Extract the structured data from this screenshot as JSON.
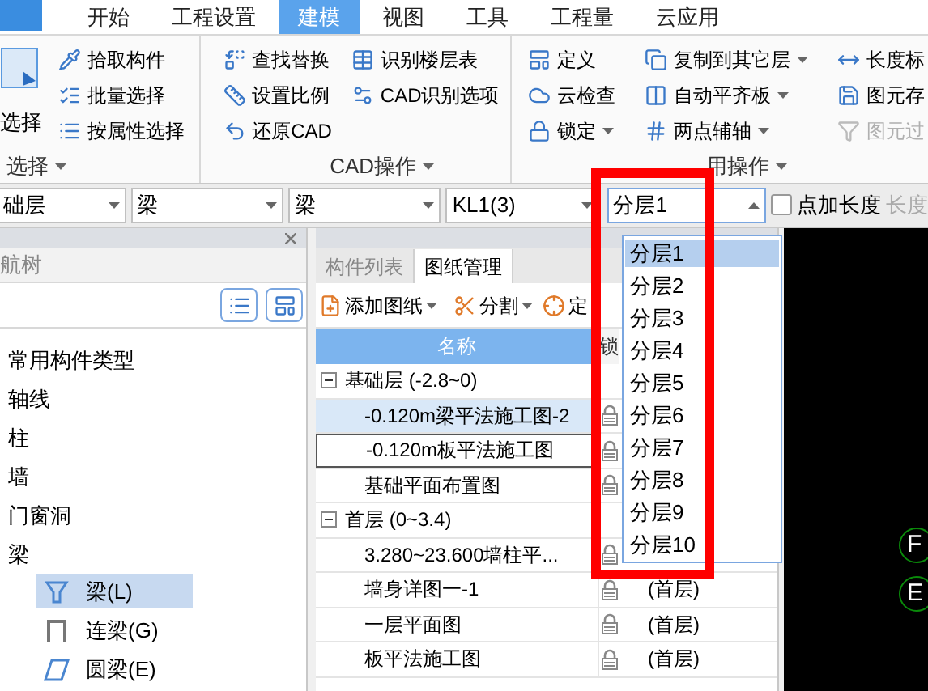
{
  "tabs": [
    {
      "label": "开始",
      "selected": false
    },
    {
      "label": "工程设置",
      "selected": false
    },
    {
      "label": "建模",
      "selected": true
    },
    {
      "label": "视图",
      "selected": false
    },
    {
      "label": "工具",
      "selected": false
    },
    {
      "label": "工程量",
      "selected": false
    },
    {
      "label": "云应用",
      "selected": false
    }
  ],
  "ribbon": {
    "groups": [
      {
        "kind": "select",
        "label": "选择",
        "large_button": "选择",
        "columns": [
          [
            {
              "label": "拾取构件",
              "has_menu": false,
              "disabled": false
            },
            {
              "label": "批量选择",
              "has_menu": false,
              "disabled": false
            },
            {
              "label": "按属性选择",
              "has_menu": false,
              "disabled": false
            }
          ]
        ]
      },
      {
        "kind": "cad",
        "label": "CAD操作",
        "columns": [
          [
            {
              "label": "查找替换",
              "has_menu": false,
              "disabled": false
            },
            {
              "label": "设置比例",
              "has_menu": false,
              "disabled": false
            },
            {
              "label": "还原CAD",
              "has_menu": false,
              "disabled": false
            }
          ],
          [
            {
              "label": "识别楼层表",
              "has_menu": false,
              "disabled": false
            },
            {
              "label": "CAD识别选项",
              "has_menu": false,
              "disabled": false
            }
          ]
        ]
      },
      {
        "kind": "common",
        "label": "用操作",
        "columns": [
          [
            {
              "label": "定义",
              "has_menu": false,
              "disabled": false
            },
            {
              "label": "云检查",
              "has_menu": false,
              "disabled": false
            },
            {
              "label": "锁定",
              "has_menu": true,
              "disabled": false
            }
          ],
          [
            {
              "label": "复制到其它层",
              "has_menu": true,
              "disabled": false
            },
            {
              "label": "自动平齐板",
              "has_menu": true,
              "disabled": false
            },
            {
              "label": "两点辅轴",
              "has_menu": true,
              "disabled": false
            }
          ],
          [
            {
              "label": "长度标",
              "has_menu": false,
              "disabled": false
            },
            {
              "label": "图元存",
              "has_menu": false,
              "disabled": false
            },
            {
              "label": "图元过",
              "has_menu": false,
              "disabled": true
            }
          ]
        ]
      }
    ]
  },
  "selectors": [
    {
      "value": "础层"
    },
    {
      "value": "梁"
    },
    {
      "value": "梁"
    },
    {
      "value": "KL1(3)"
    }
  ],
  "layer_select": {
    "value": "分层1",
    "options": [
      {
        "label": "分层1",
        "selected": true
      },
      {
        "label": "分层2",
        "selected": false
      },
      {
        "label": "分层3",
        "selected": false
      },
      {
        "label": "分层4",
        "selected": false
      },
      {
        "label": "分层5",
        "selected": false
      },
      {
        "label": "分层6",
        "selected": false
      },
      {
        "label": "分层7",
        "selected": false
      },
      {
        "label": "分层8",
        "selected": false
      },
      {
        "label": "分层9",
        "selected": false
      },
      {
        "label": "分层10",
        "selected": false
      }
    ]
  },
  "length_checkbox": {
    "label": "点加长度",
    "checked": false
  },
  "length_field": {
    "label": "长度"
  },
  "nav_tree": {
    "title": "航树",
    "items": [
      {
        "label": "常用构件类型"
      },
      {
        "label": "轴线"
      },
      {
        "label": "柱"
      },
      {
        "label": "墙"
      },
      {
        "label": "门窗洞"
      },
      {
        "label": "梁",
        "children": [
          {
            "label": "梁(L)",
            "selected": true
          },
          {
            "label": "连梁(G)",
            "selected": false
          },
          {
            "label": "圆梁(E)",
            "selected": false
          }
        ]
      }
    ]
  },
  "drawing_panel": {
    "tabs": [
      {
        "label": "构件列表",
        "selected": false
      },
      {
        "label": "图纸管理",
        "selected": true
      }
    ],
    "toolbar": [
      {
        "label": "添加图纸",
        "has_menu": true
      },
      {
        "label": "分割",
        "has_menu": true
      },
      {
        "label": "定",
        "has_menu": false
      }
    ],
    "columns": [
      "名称",
      "锁"
    ],
    "groups": [
      {
        "name": "基础层 (-2.8~0)",
        "expanded": true,
        "children": [
          {
            "name": "-0.120m梁平法施工图-2",
            "selected": true,
            "focused": false
          },
          {
            "name": "-0.120m板平法施工图",
            "selected": false,
            "focused": true
          },
          {
            "name": "基础平面布置图",
            "selected": false,
            "focused": false
          }
        ]
      },
      {
        "name": "首层 (0~3.4)",
        "expanded": true,
        "children": [
          {
            "name": "3.280~23.600墙柱平...",
            "selected": false,
            "focused": false
          },
          {
            "name": "墙身详图一-1",
            "selected": false,
            "focused": false,
            "floor": "(首层)"
          },
          {
            "name": "一层平面图",
            "selected": false,
            "focused": false,
            "floor": "(首层)"
          },
          {
            "name": "板平法施工图",
            "selected": false,
            "focused": false,
            "floor": "(首层)"
          }
        ]
      }
    ]
  },
  "canvas": {
    "axis_labels": [
      "F",
      "E"
    ]
  }
}
